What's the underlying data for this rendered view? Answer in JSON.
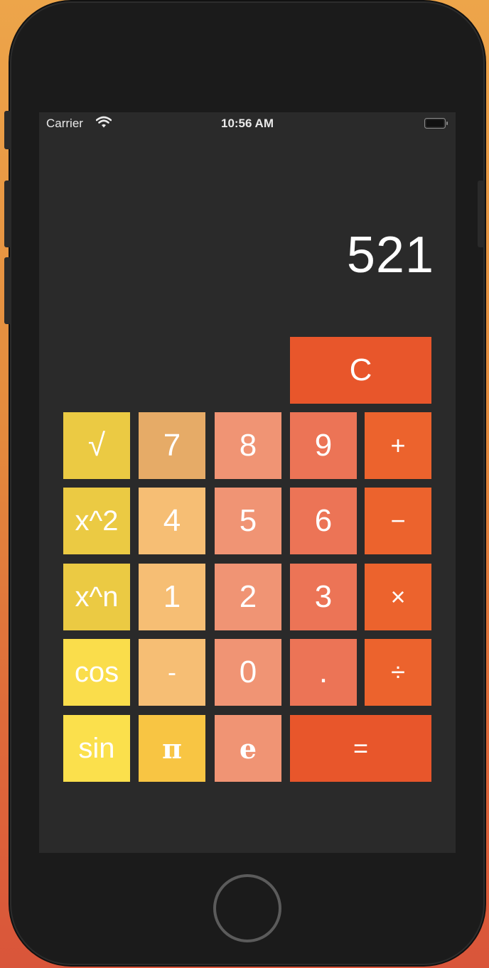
{
  "status_bar": {
    "carrier": "Carrier",
    "time": "10:56 AM"
  },
  "display": {
    "value": "521"
  },
  "keys": {
    "clear": "C",
    "sqrt": "√",
    "square": "x^2",
    "power": "x^n",
    "cos": "cos",
    "sin": "sin",
    "seven": "7",
    "eight": "8",
    "nine": "9",
    "plus": "+",
    "four": "4",
    "five": "5",
    "six": "6",
    "minus": "−",
    "one": "1",
    "two": "2",
    "three": "3",
    "multiply": "×",
    "negate": "-",
    "zero": "0",
    "decimal": ".",
    "divide": "÷",
    "pi": "π",
    "e": "e",
    "equals": "="
  },
  "colors": {
    "background": "#2a2a2a",
    "yellow_function": "#eccc45",
    "yellow_bright": "#fbe04c",
    "number_tan": "#f6be74",
    "number_tan_dark": "#e6ab67",
    "number_salmon": "#f09474",
    "number_coral": "#ec7456",
    "operator_orange": "#ec632d",
    "clear_equals_orange": "#e8562b",
    "pi_yellow": "#f8c543"
  }
}
